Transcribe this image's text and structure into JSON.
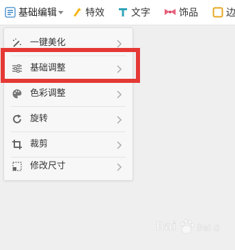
{
  "toolbar": {
    "items": [
      {
        "label": "基础编辑",
        "icon": "edit-icon",
        "active": true
      },
      {
        "label": "特效",
        "icon": "magic-wand-icon"
      },
      {
        "label": "文字",
        "icon": "text-icon"
      },
      {
        "label": "饰品",
        "icon": "bow-icon"
      },
      {
        "label": "边",
        "icon": "border-icon"
      }
    ]
  },
  "menu": {
    "items": [
      {
        "label": "一键美化",
        "icon": "wand-sparkle-icon"
      },
      {
        "label": "基础调整",
        "icon": "sliders-icon"
      },
      {
        "label": "色彩调整",
        "icon": "palette-icon"
      },
      {
        "label": "旋转",
        "icon": "rotate-icon"
      },
      {
        "label": "裁剪",
        "icon": "crop-icon"
      },
      {
        "label": "修改尺寸",
        "icon": "resize-icon"
      }
    ]
  },
  "watermark": {
    "text": "Bai du 经验",
    "logo": "baidu-paw-logo"
  },
  "colors": {
    "highlight": "#e53935",
    "accent_yellow": "#f3b51b",
    "accent_teal": "#2fa3b8",
    "accent_pink": "#e8607a",
    "accent_gold": "#e6a51d"
  }
}
